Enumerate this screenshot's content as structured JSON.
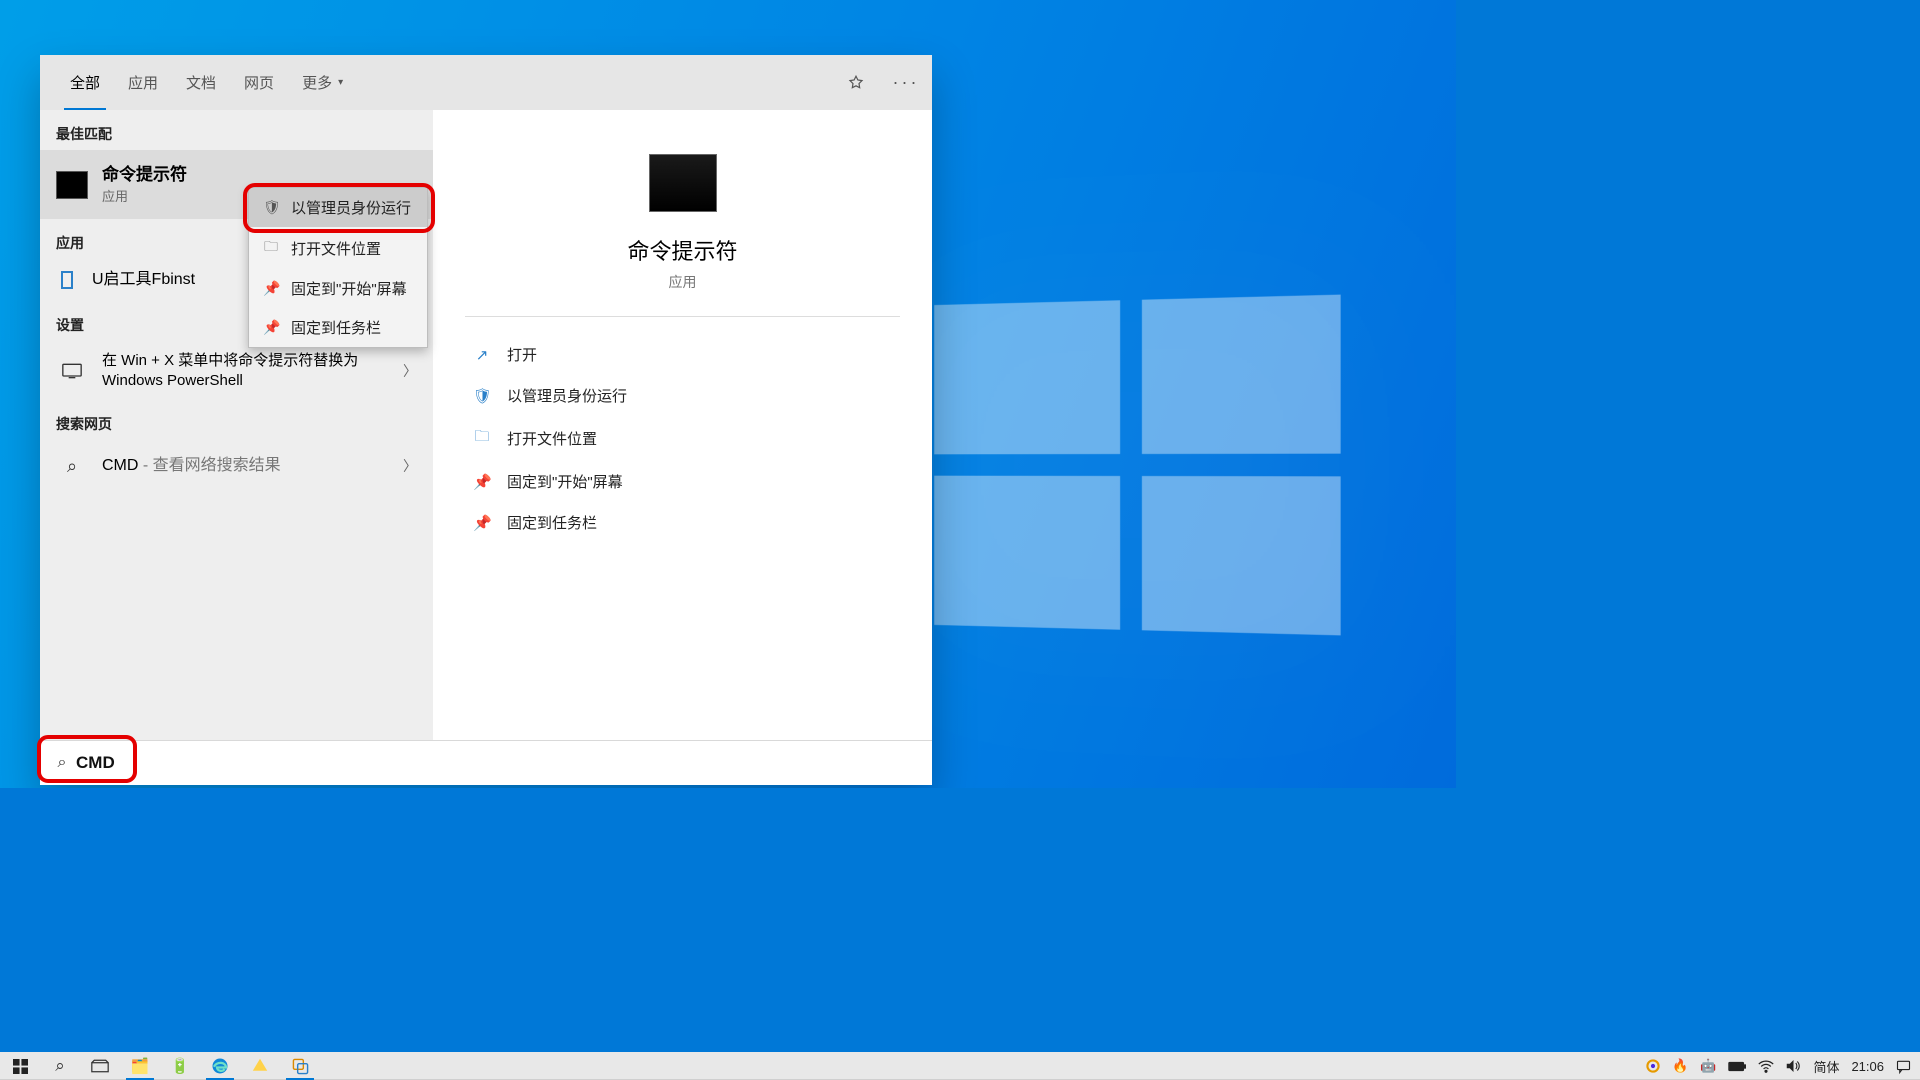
{
  "tabs": {
    "all": "全部",
    "apps": "应用",
    "docs": "文档",
    "web": "网页",
    "more": "更多"
  },
  "sections": {
    "best": "最佳匹配",
    "apps": "应用",
    "settings": "设置",
    "web": "搜索网页"
  },
  "bestMatch": {
    "title": "命令提示符",
    "sub": "应用"
  },
  "appResult": {
    "title": "U启工具Fbinst"
  },
  "settingResult": {
    "title": "在 Win + X 菜单中将命令提示符替换为 Windows PowerShell"
  },
  "webResult": {
    "title": "CMD",
    "sub": " - 查看网络搜索结果"
  },
  "contextMenu": {
    "runAdmin": "以管理员身份运行",
    "openLoc": "打开文件位置",
    "pinStart": "固定到\"开始\"屏幕",
    "pinTaskbar": "固定到任务栏"
  },
  "detail": {
    "title": "命令提示符",
    "sub": "应用",
    "actions": {
      "open": "打开",
      "runAdmin": "以管理员身份运行",
      "openLoc": "打开文件位置",
      "pinStart": "固定到\"开始\"屏幕",
      "pinTaskbar": "固定到任务栏"
    }
  },
  "search": {
    "value": "CMD"
  },
  "tray": {
    "ime": "简体",
    "clock": "21:06"
  }
}
